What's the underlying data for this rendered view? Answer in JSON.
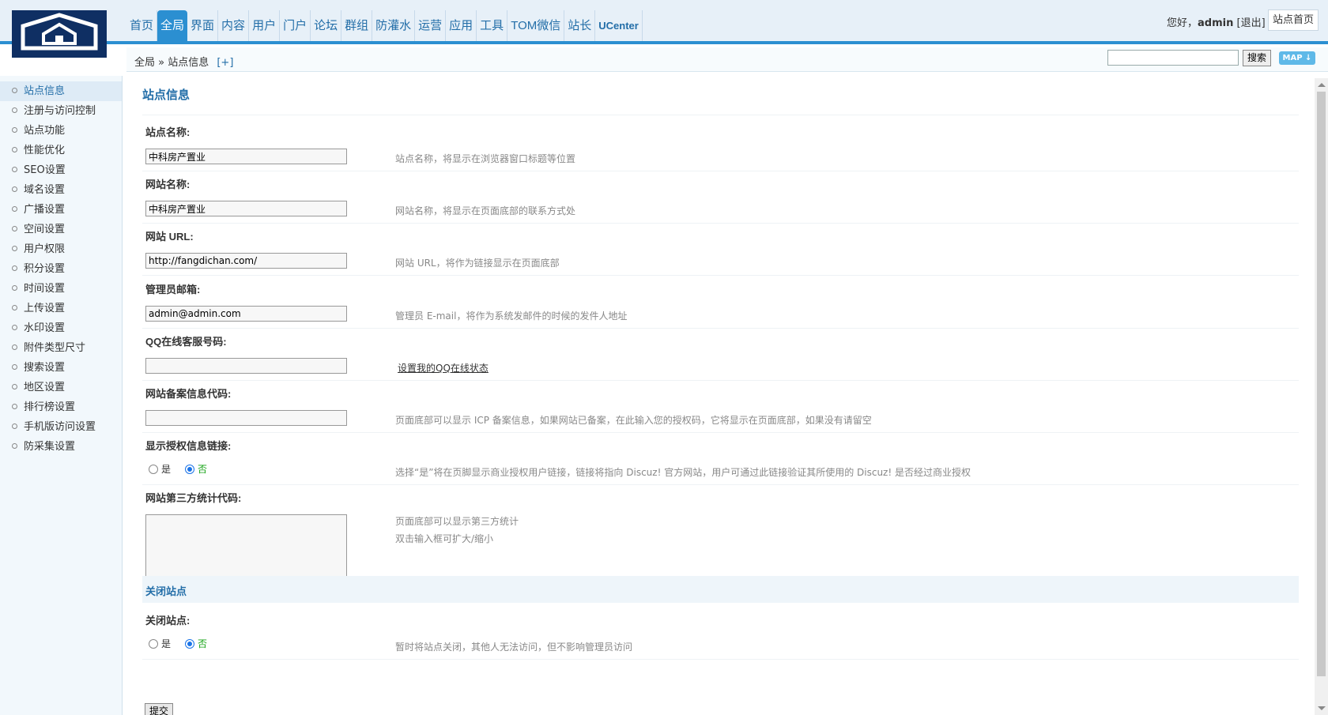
{
  "header": {
    "logo_icon": "house-logo-icon",
    "nav": [
      {
        "label": "首页",
        "active": false,
        "small": false
      },
      {
        "label": "全局",
        "active": true,
        "small": false
      },
      {
        "label": "界面",
        "active": false,
        "small": false
      },
      {
        "label": "内容",
        "active": false,
        "small": false
      },
      {
        "label": "用户",
        "active": false,
        "small": false
      },
      {
        "label": "门户",
        "active": false,
        "small": false
      },
      {
        "label": "论坛",
        "active": false,
        "small": false
      },
      {
        "label": "群组",
        "active": false,
        "small": false
      },
      {
        "label": "防灌水",
        "active": false,
        "small": false
      },
      {
        "label": "运营",
        "active": false,
        "small": false
      },
      {
        "label": "应用",
        "active": false,
        "small": false
      },
      {
        "label": "工具",
        "active": false,
        "small": false
      },
      {
        "label": "TOM微信",
        "active": false,
        "small": false
      },
      {
        "label": "站长",
        "active": false,
        "small": false
      },
      {
        "label": "UCenter",
        "active": false,
        "small": true
      }
    ],
    "greeting": "您好，",
    "username": "admin",
    "logout": "[退出]",
    "site_home": "站点首页"
  },
  "crumb": {
    "path": "全局 » 站点信息",
    "plus": "[+]",
    "search_value": "",
    "search_button": "搜索",
    "map_button": "MAP ↓"
  },
  "sidebar": {
    "items": [
      {
        "label": "站点信息",
        "active": true
      },
      {
        "label": "注册与访问控制",
        "active": false
      },
      {
        "label": "站点功能",
        "active": false
      },
      {
        "label": "性能优化",
        "active": false
      },
      {
        "label": "SEO设置",
        "active": false
      },
      {
        "label": "域名设置",
        "active": false
      },
      {
        "label": "广播设置",
        "active": false
      },
      {
        "label": "空间设置",
        "active": false
      },
      {
        "label": "用户权限",
        "active": false
      },
      {
        "label": "积分设置",
        "active": false
      },
      {
        "label": "时间设置",
        "active": false
      },
      {
        "label": "上传设置",
        "active": false
      },
      {
        "label": "水印设置",
        "active": false
      },
      {
        "label": "附件类型尺寸",
        "active": false
      },
      {
        "label": "搜索设置",
        "active": false
      },
      {
        "label": "地区设置",
        "active": false
      },
      {
        "label": "排行榜设置",
        "active": false
      },
      {
        "label": "手机版访问设置",
        "active": false
      },
      {
        "label": "防采集设置",
        "active": false
      }
    ]
  },
  "main": {
    "title": "站点信息",
    "fields": {
      "site_name": {
        "label": "站点名称:",
        "value": "中科房产置业",
        "tip": "站点名称，将显示在浏览器窗口标题等位置"
      },
      "web_name": {
        "label": "网站名称:",
        "value": "中科房产置业",
        "tip": "网站名称，将显示在页面底部的联系方式处"
      },
      "web_url": {
        "label": "网站 URL:",
        "value": "http://fangdichan.com/",
        "tip": "网站 URL，将作为链接显示在页面底部"
      },
      "admin_email": {
        "label": "管理员邮箱:",
        "value": "admin@admin.com",
        "tip": "管理员 E-mail，将作为系统发邮件的时候的发件人地址"
      },
      "qq": {
        "label": "QQ在线客服号码:",
        "value": "",
        "link": "设置我的QQ在线状态"
      },
      "icp": {
        "label": "网站备案信息代码:",
        "value": "",
        "tip": "页面底部可以显示 ICP 备案信息，如果网站已备案，在此输入您的授权码，它将显示在页面底部，如果没有请留空"
      },
      "license_link": {
        "label": "显示授权信息链接:",
        "yes": "是",
        "no": "否",
        "selected": "no",
        "tip": "选择“是”将在页脚显示商业授权用户链接，链接将指向 Discuz! 官方网站，用户可通过此链接验证其所使用的 Discuz! 是否经过商业授权"
      },
      "stats_code": {
        "label": "网站第三方统计代码:",
        "value": "",
        "tip1": "页面底部可以显示第三方统计",
        "tip2": "双击输入框可扩大/缩小"
      }
    },
    "close_section": {
      "title": "关闭站点",
      "label": "关闭站点:",
      "yes": "是",
      "no": "否",
      "selected": "no",
      "tip": "暂时将站点关闭，其他人无法访问，但不影响管理员访问"
    },
    "submit": "提交"
  }
}
